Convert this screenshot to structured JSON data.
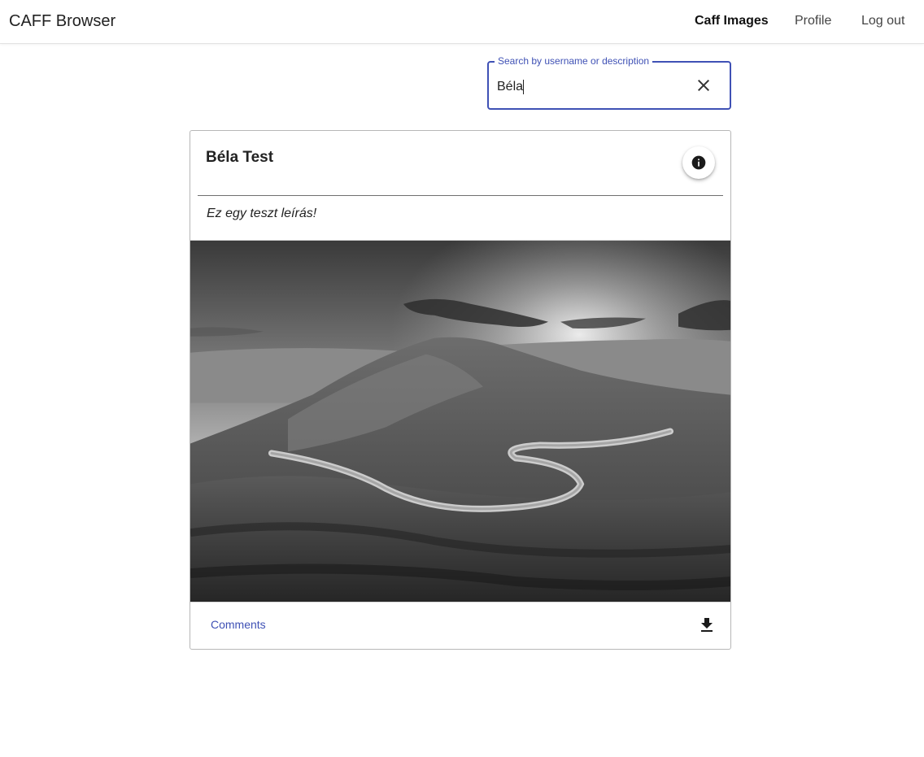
{
  "app": {
    "brand": "CAFF Browser"
  },
  "nav": {
    "items": [
      {
        "label": "Caff Images",
        "active": true
      },
      {
        "label": "Profile",
        "active": false
      },
      {
        "label": "Log out",
        "active": false
      }
    ]
  },
  "search": {
    "label": "Search by username or description",
    "value": "Béla",
    "clear_icon": "close-icon"
  },
  "card": {
    "title": "Béla Test",
    "info_icon": "info-icon",
    "description": "Ez egy teszt leírás!",
    "image_subject": "grayscale landscape with winding road through hills at sunset",
    "comments_label": "Comments",
    "download_icon": "download-icon"
  },
  "colors": {
    "accent": "#3f51b5",
    "text": "#222222"
  }
}
